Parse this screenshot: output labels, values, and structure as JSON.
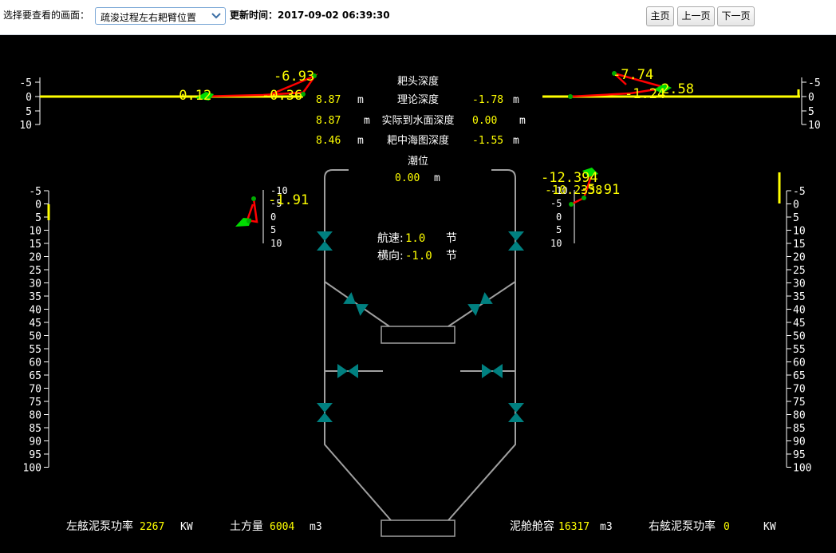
{
  "toolbar": {
    "select_label": "选择要查看的画面：",
    "selected_screen": "疏浚过程左右耙臂位置",
    "update_label": "更新时间：2017-09-02 06:39:30",
    "home_label": "主页",
    "prev_label": "上一页",
    "next_label": "下一页"
  },
  "depth_panel": {
    "title": "耙头深度",
    "rows": [
      {
        "left": "8.87",
        "left_unit": "m",
        "label": "理论深度",
        "right": "-1.78",
        "right_unit": "m"
      },
      {
        "left": "8.87",
        "left_unit": "m",
        "label": "实际到水面深度",
        "right": "0.00",
        "right_unit": "m"
      },
      {
        "left": "8.46",
        "left_unit": "m",
        "label": "耙中海图深度",
        "right": "-1.55",
        "right_unit": "m"
      }
    ],
    "tide_label": "潮位",
    "tide_value": "0.00",
    "tide_unit": "m"
  },
  "speed": {
    "speed_label": "航速:",
    "speed_value": "1.0",
    "speed_unit": "节",
    "lateral_label": "横向:",
    "lateral_value": "-1.0",
    "lateral_unit": "节"
  },
  "arms": {
    "left_top": {
      "a": "-0.12",
      "b": "-0.36",
      "c": "-6.93"
    },
    "right_top": {
      "a": "-7.74",
      "b": "-1.24",
      "c": "2.58"
    },
    "left_mid": {
      "a": "-1.91"
    },
    "right_mid": {
      "a": "-12.394",
      "b": "-10.2338",
      "c": "-5.91"
    }
  },
  "scales": {
    "top_ticks": [
      "-5",
      "0",
      "5",
      "10"
    ],
    "side_ticks": [
      "-5",
      "0",
      "5",
      "10",
      "15",
      "20",
      "25",
      "30",
      "35",
      "40",
      "45",
      "50",
      "55",
      "60",
      "65",
      "70",
      "75",
      "80",
      "85",
      "90",
      "95",
      "100"
    ],
    "small_ticks": [
      "-10",
      "-5",
      "0",
      "5",
      "10"
    ]
  },
  "bottom": {
    "left_pump_label": "左舷泥泵功率",
    "left_pump_value": "2267",
    "left_pump_unit": "KW",
    "volume_label": "土方量",
    "volume_value": "6004",
    "volume_unit": "m3",
    "hold_label": "泥舱舱容",
    "hold_value": "16317",
    "hold_unit": "m3",
    "right_pump_label": "右舷泥泵功率",
    "right_pump_value": "0",
    "right_pump_unit": "KW"
  },
  "colors": {
    "accent_yellow": "#ffff00",
    "arm_red": "#ff0000",
    "joint_green": "#00cc00",
    "valve_teal": "#008080",
    "pipe_gray": "#a0a0a0"
  }
}
